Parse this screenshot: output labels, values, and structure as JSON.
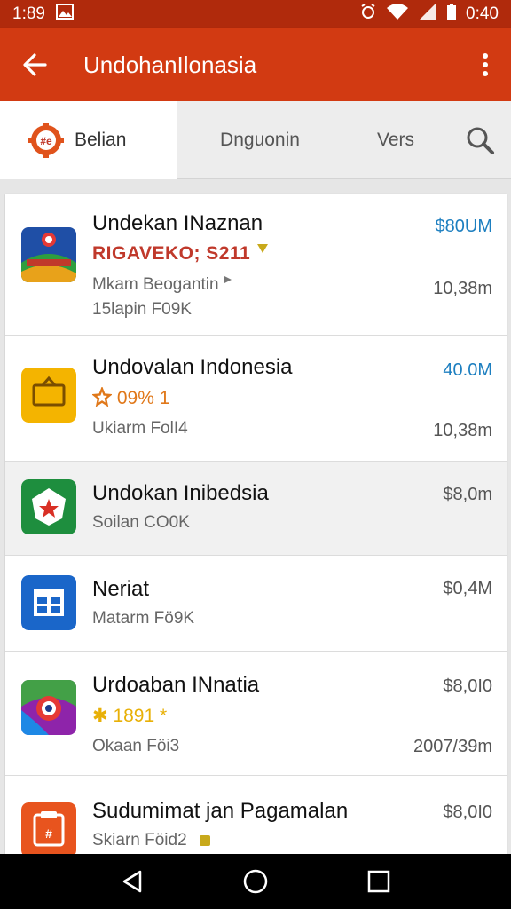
{
  "status_bar": {
    "time": "1:89",
    "clock": "0:40"
  },
  "app_bar": {
    "title": "UndohanIlonasia"
  },
  "tabs": {
    "tab1": "Belian",
    "tab2": "Dnguonin",
    "tab3": "Vers"
  },
  "rows": [
    {
      "title": "Undekan INaznan",
      "subtitle": "RIGAVEKO; S211",
      "meta": "Mkam Beogantin",
      "meta2": "15lapin F09K",
      "price": "$80UM",
      "size": "10,38m"
    },
    {
      "title": "Undovalan Indonesia",
      "subtitle": "09% 1",
      "meta": "Ukiarm FolI4",
      "price": "40.0M",
      "size": "10,38m"
    },
    {
      "title": "Undokan Inibedsia",
      "meta": "Soilan CO0K",
      "price": "$8,0m"
    },
    {
      "title": "Neriat",
      "meta": "Matarm Fö9K",
      "price": "$0,4M"
    },
    {
      "title": "Urdoaban INnatia",
      "subtitle": "1891",
      "meta": "Okaan Föi3",
      "price": "$8,0I0",
      "size": "2007/39m"
    },
    {
      "title": "Sudumimat jan Pagamalan",
      "meta": "Skiarn Föid2",
      "price": "$8,0I0"
    }
  ],
  "colors": {
    "status_bar": "#b02a0c",
    "app_bar": "#d23a12",
    "price_blue": "#1d7fc0",
    "subtitle_red": "#c0392b"
  },
  "icons": {
    "back": "arrow-left-icon",
    "menu": "more-vert-icon",
    "search": "search-icon",
    "nav_back": "triangle-back-icon",
    "nav_home": "circle-home-icon",
    "nav_recents": "square-recents-icon"
  }
}
